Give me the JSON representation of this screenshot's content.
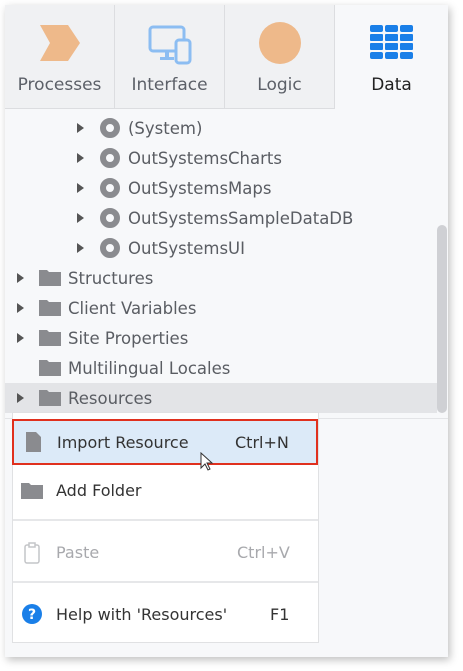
{
  "tabs": [
    {
      "label": "Processes",
      "icon": "processes-chevron-icon"
    },
    {
      "label": "Interface",
      "icon": "monitor-mobile-icon"
    },
    {
      "label": "Logic",
      "icon": "logic-circle-icon"
    },
    {
      "label": "Data",
      "icon": "data-grid-icon"
    }
  ],
  "active_tab": "Data",
  "tree": {
    "modules": [
      "(System)",
      "OutSystemsCharts",
      "OutSystemsMaps",
      "OutSystemsSampleDataDB",
      "OutSystemsUI"
    ],
    "folders": [
      "Structures",
      "Client Variables",
      "Site Properties",
      "Multilingual Locales",
      "Resources"
    ]
  },
  "context_menu": {
    "import": {
      "label": "Import Resource",
      "shortcut": "Ctrl+N"
    },
    "add_folder": {
      "label": "Add Folder"
    },
    "paste": {
      "label": "Paste",
      "shortcut": "Ctrl+V"
    },
    "help": {
      "label": "Help with 'Resources'",
      "shortcut": "F1"
    }
  },
  "colors": {
    "accent": "#1a7fe8",
    "highlight_border": "#e0301e",
    "highlight_bg": "#dceaf8",
    "orange": "#eeb98a"
  }
}
